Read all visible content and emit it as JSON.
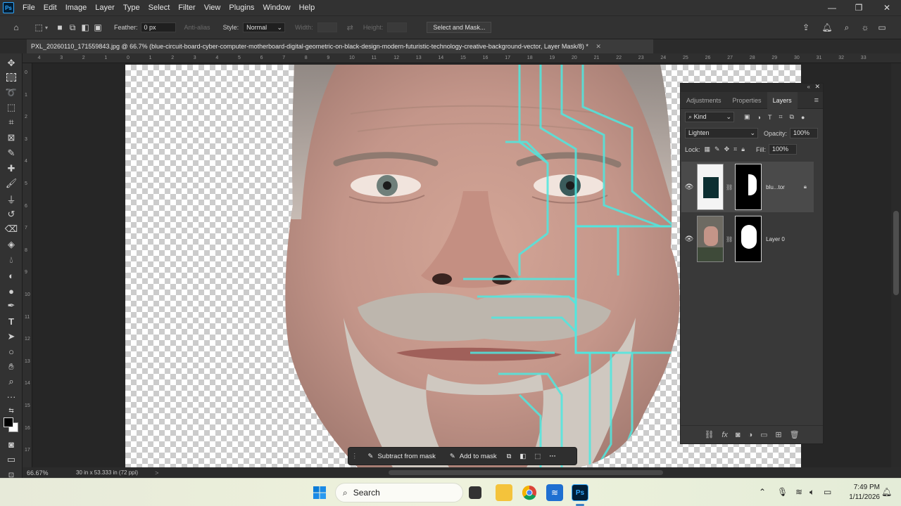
{
  "menubar": {
    "logo": "Ps",
    "items": [
      "File",
      "Edit",
      "Image",
      "Layer",
      "Type",
      "Select",
      "Filter",
      "View",
      "Plugins",
      "Window",
      "Help"
    ],
    "controls": [
      "minimize-icon",
      "restore-icon",
      "close-icon"
    ]
  },
  "options": {
    "feather_label": "Feather:",
    "feather_value": "0 px",
    "antialias_label": "Anti-alias",
    "style_label": "Style:",
    "style_value": "Normal",
    "width_label": "Width:",
    "height_label": "Height:",
    "select_mask_label": "Select and Mask..."
  },
  "document": {
    "tab_title": "PXL_20260110_171559843.jpg @ 66.7% (blue-circuit-board-cyber-computer-motherboard-digital-geometric-on-black-design-modern-futuristic-technology-creative-background-vector, Layer Mask/8) *"
  },
  "ruler": {
    "top_ticks": [
      "4",
      "3",
      "2",
      "1",
      "0",
      "1",
      "2",
      "3",
      "4",
      "5",
      "6",
      "7",
      "8",
      "9",
      "10",
      "11",
      "12",
      "13",
      "14",
      "15",
      "16",
      "17",
      "18",
      "19",
      "20",
      "21",
      "22",
      "23",
      "24",
      "25",
      "26",
      "27",
      "28",
      "29",
      "30",
      "31",
      "32",
      "33"
    ],
    "left_ticks": [
      "0",
      "1",
      "2",
      "3",
      "4",
      "5",
      "6",
      "7",
      "8",
      "9",
      "10",
      "11",
      "12",
      "13",
      "14",
      "15",
      "16",
      "17"
    ]
  },
  "status": {
    "zoom": "66.67%",
    "doc_size": "30 in x 53.333 in (72 ppi)",
    "arrow": ">"
  },
  "panel": {
    "tabs": [
      "Adjustments",
      "Properties",
      "Layers"
    ],
    "active_tab": "Layers",
    "kind_label": "Kind",
    "blend_mode": "Lighten",
    "opacity_label": "Opacity:",
    "opacity_value": "100%",
    "lock_label": "Lock:",
    "fill_label": "Fill:",
    "fill_value": "100%",
    "layers": [
      {
        "name": "blu...tor",
        "selected": true
      },
      {
        "name": "Layer 0",
        "selected": false
      }
    ]
  },
  "context": {
    "subtract_label": "Subtract from mask",
    "add_label": "Add to mask",
    "more": "···"
  },
  "taskbar": {
    "search_label": "Search",
    "time": "7:49 PM",
    "date": "1/11/2026"
  },
  "colors": {
    "accent": "#31a8ff",
    "panel_bg": "#393939",
    "circuit": "#4ee8e0"
  }
}
